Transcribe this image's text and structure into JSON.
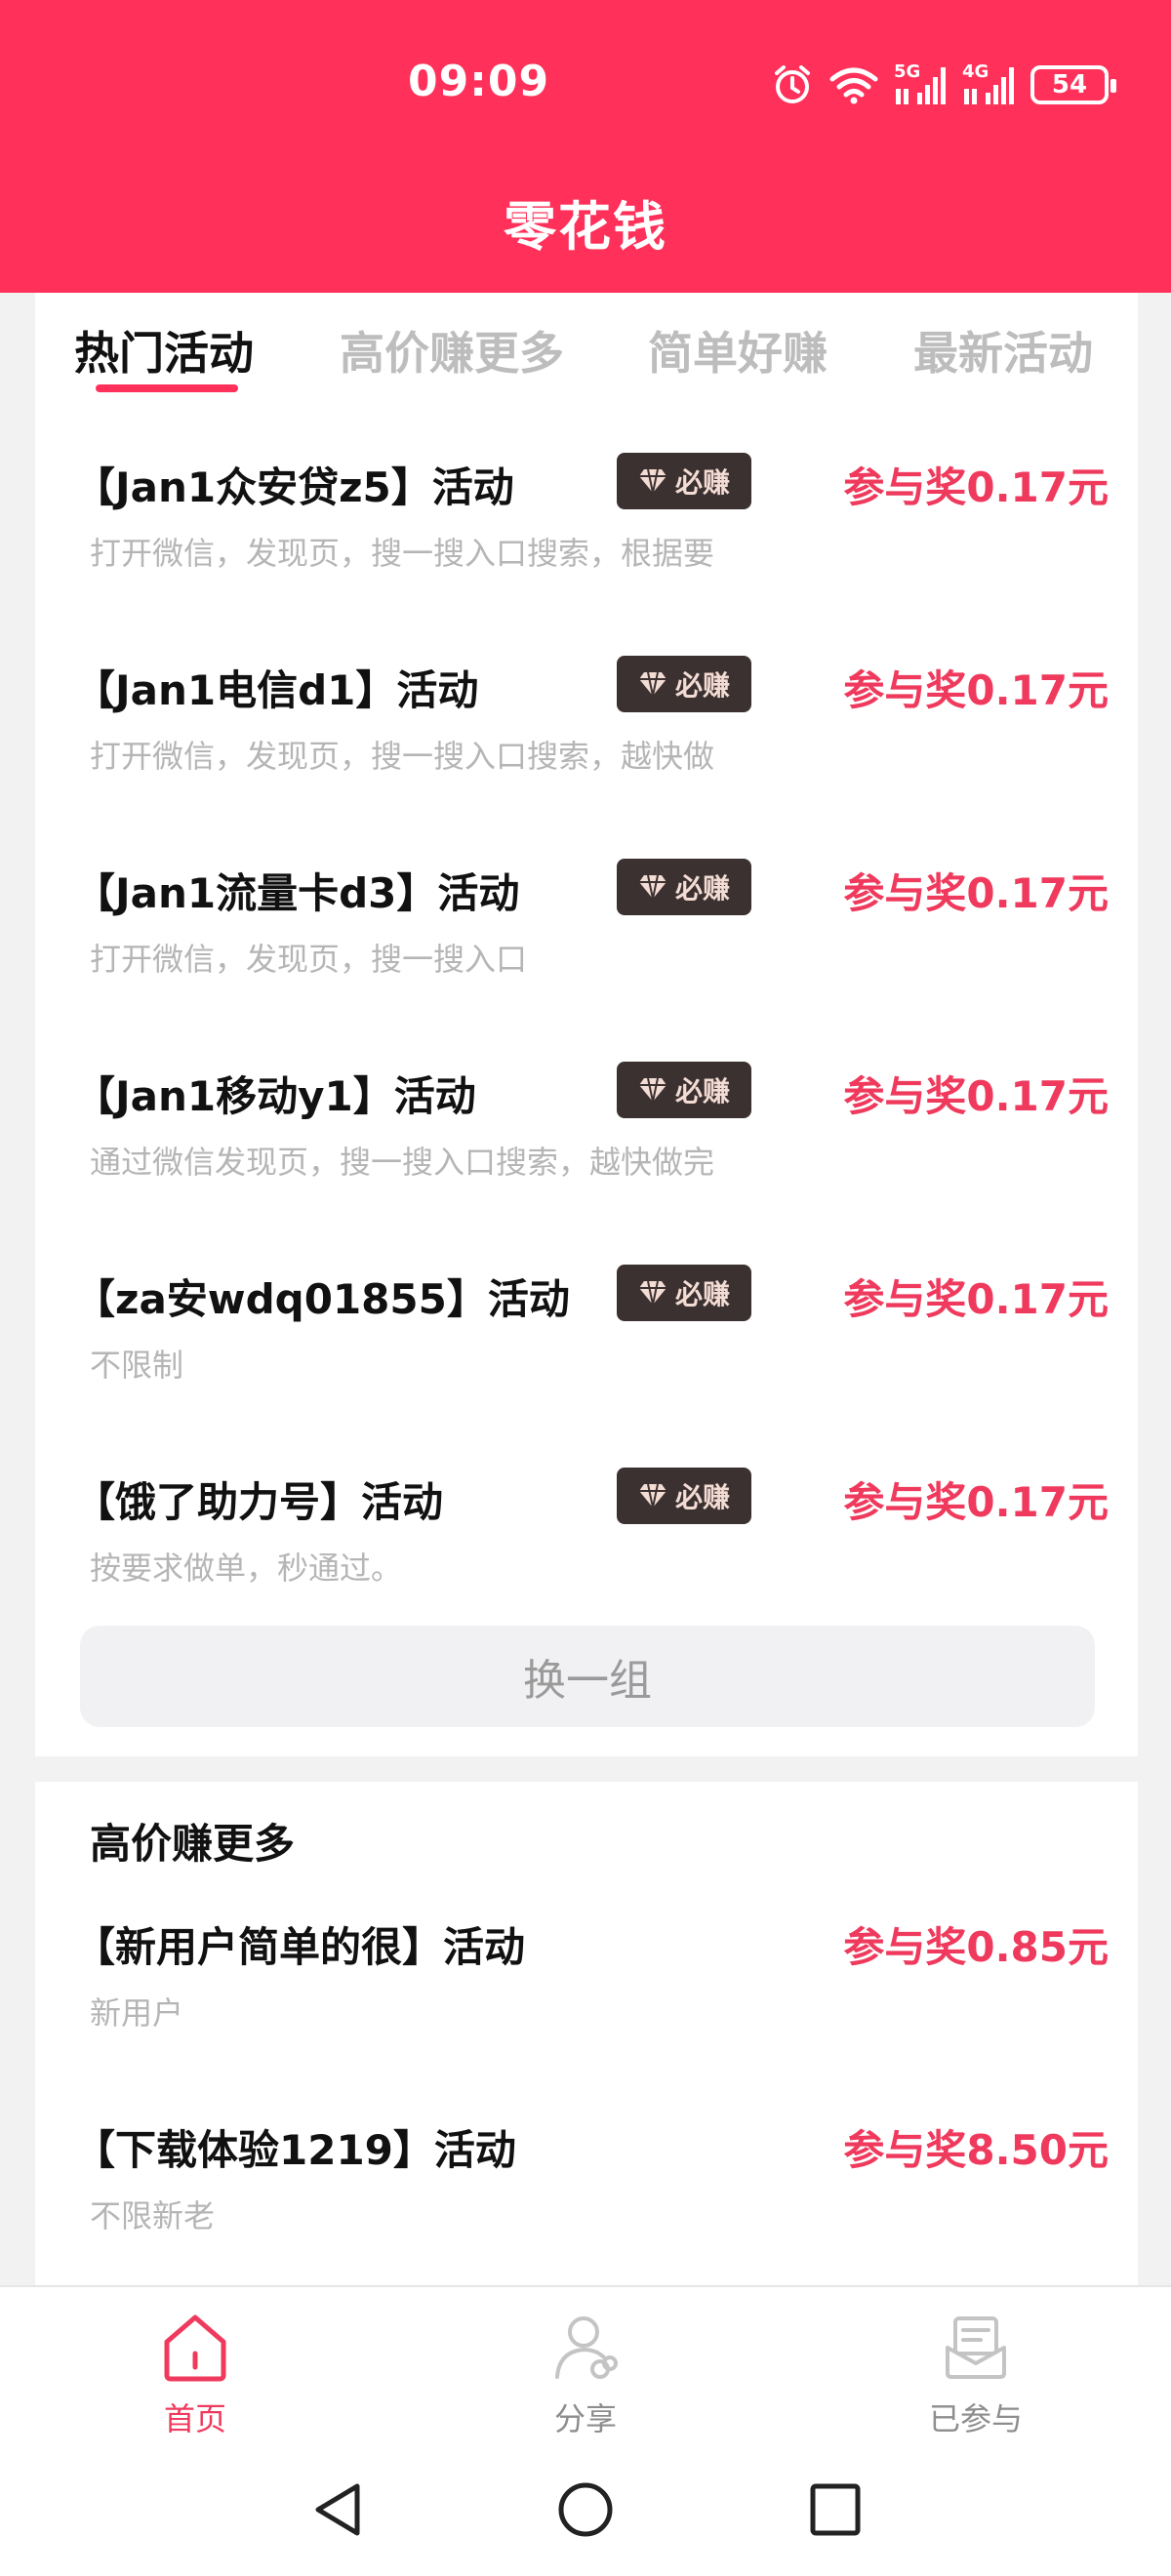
{
  "status": {
    "time": "09:09",
    "battery": "54",
    "net1": "5G",
    "net2": "4G"
  },
  "app": {
    "title": "零花钱"
  },
  "tabs": [
    {
      "label": "热门活动"
    },
    {
      "label": "高价赚更多"
    },
    {
      "label": "简单好赚"
    },
    {
      "label": "最新活动"
    }
  ],
  "hot_items": [
    {
      "title": "【Jan1众安贷z5】活动",
      "badge": "必赚",
      "reward": "参与奖0.17元",
      "desc": "打开微信，发现页，搜一搜入口搜索，根据要"
    },
    {
      "title": "【Jan1电信d1】活动",
      "badge": "必赚",
      "reward": "参与奖0.17元",
      "desc": "打开微信，发现页，搜一搜入口搜索，越快做"
    },
    {
      "title": "【Jan1流量卡d3】活动",
      "badge": "必赚",
      "reward": "参与奖0.17元",
      "desc": "打开微信，发现页，搜一搜入口"
    },
    {
      "title": "【Jan1移动y1】活动",
      "badge": "必赚",
      "reward": "参与奖0.17元",
      "desc": "通过微信发现页，搜一搜入口搜索，越快做完"
    },
    {
      "title": "【za安wdq01855】活动",
      "badge": "必赚",
      "reward": "参与奖0.17元",
      "desc": "不限制"
    },
    {
      "title": "【饿了助力号】活动",
      "badge": "必赚",
      "reward": "参与奖0.17元",
      "desc": "按要求做单，秒通过。"
    }
  ],
  "refresh_label": "换一组",
  "high_section": {
    "title": "高价赚更多",
    "items": [
      {
        "title": "【新用户简单的很】活动",
        "reward": "参与奖0.85元",
        "desc": "新用户"
      },
      {
        "title": "【下载体验1219】活动",
        "reward": "参与奖8.50元",
        "desc": "不限新老"
      }
    ]
  },
  "bottom_nav": [
    {
      "label": "首页",
      "icon": "home-icon"
    },
    {
      "label": "分享",
      "icon": "share-user-icon"
    },
    {
      "label": "已参与",
      "icon": "joined-envelope-icon"
    }
  ],
  "colors": {
    "brand": "#ff3059",
    "reward": "#ef3a5d",
    "badge_bg": "#3c3131"
  }
}
